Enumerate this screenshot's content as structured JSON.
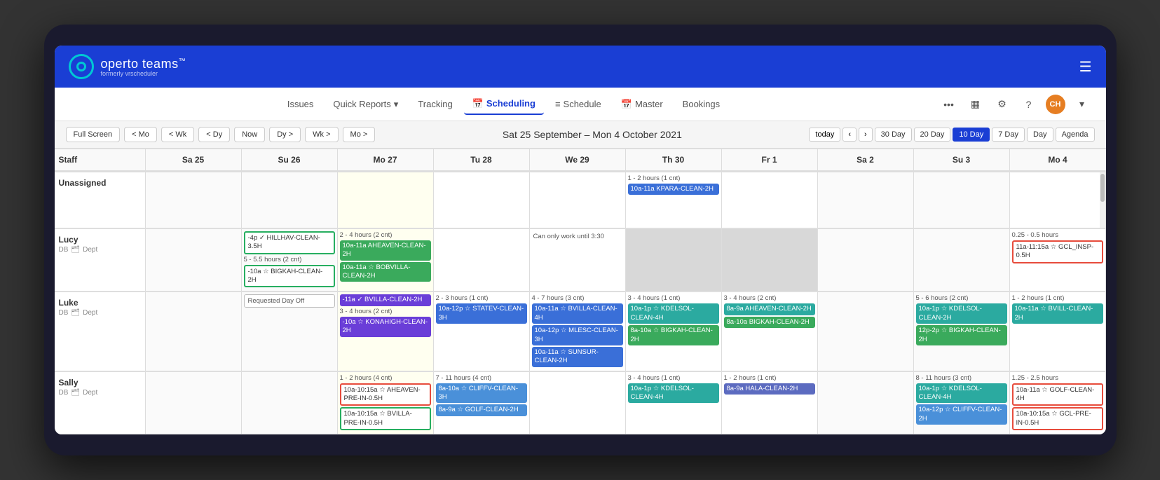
{
  "app": {
    "name": "operto",
    "name2": "teams",
    "trademark": "™",
    "subtitle": "formerly vrscheduler"
  },
  "nav": {
    "links": [
      {
        "id": "issues",
        "label": "Issues",
        "active": false
      },
      {
        "id": "quick-reports",
        "label": "Quick Reports",
        "active": false,
        "hasDropdown": true
      },
      {
        "id": "tracking",
        "label": "Tracking",
        "active": false
      },
      {
        "id": "scheduling",
        "label": "Scheduling",
        "active": true,
        "hasIcon": true
      },
      {
        "id": "schedule",
        "label": "Schedule",
        "active": false,
        "hasIcon": true
      },
      {
        "id": "master",
        "label": "Master",
        "active": false,
        "hasIcon": true
      },
      {
        "id": "bookings",
        "label": "Bookings",
        "active": false
      }
    ]
  },
  "toolbar": {
    "full_screen": "Full Screen",
    "prev_mo": "< Mo",
    "prev_wk": "< Wk",
    "prev_dy": "< Dy",
    "now": "Now",
    "next_dy": "Dy >",
    "next_wk": "Wk >",
    "next_mo": "Mo >",
    "date_range": "Sat 25 September – Mon 4 October 2021",
    "today": "today",
    "views": [
      "30 Day",
      "20 Day",
      "10 Day",
      "7 Day",
      "Day",
      "Agenda"
    ],
    "active_view": "10 Day"
  },
  "calendar": {
    "columns": [
      {
        "id": "staff",
        "label": "Staff"
      },
      {
        "id": "sa25",
        "label": "Sa 25"
      },
      {
        "id": "su26",
        "label": "Su 26"
      },
      {
        "id": "mo27",
        "label": "Mo 27"
      },
      {
        "id": "tu28",
        "label": "Tu 28"
      },
      {
        "id": "we29",
        "label": "We 29"
      },
      {
        "id": "th30",
        "label": "Th 30"
      },
      {
        "id": "fr1",
        "label": "Fr 1"
      },
      {
        "id": "sa2",
        "label": "Sa 2"
      },
      {
        "id": "su3",
        "label": "Su 3"
      },
      {
        "id": "mo4",
        "label": "Mo 4"
      }
    ],
    "rows": [
      {
        "id": "unassigned",
        "name": "Unassigned",
        "sub": "",
        "cells": {
          "sa25": {
            "events": []
          },
          "su26": {
            "events": []
          },
          "mo27": {
            "bg": "yellow",
            "events": []
          },
          "tu28": {
            "events": []
          },
          "we29": {
            "events": []
          },
          "th30": {
            "events": [
              {
                "type": "summary",
                "text": "1 - 2 hours (1 cnt)"
              },
              {
                "color": "blue",
                "text": "10a-11a KPARA-CLEAN-2H"
              }
            ]
          },
          "fr1": {
            "events": []
          },
          "sa2": {
            "events": []
          },
          "su3": {
            "events": []
          },
          "mo4": {
            "events": []
          }
        }
      },
      {
        "id": "lucy",
        "name": "Lucy",
        "sub": "DB Dept",
        "cells": {
          "sa25": {
            "events": []
          },
          "su26": {
            "events": [
              {
                "color": "outline-green",
                "text": "-4p ✓ HILLHAV-CLEAN-3.5H"
              },
              {
                "type": "summary",
                "text": "5 - 5.5 hours (2 cnt)"
              },
              {
                "color": "outline-green",
                "text": "-10a ☆ BIGKAH-CLEAN-2H"
              }
            ]
          },
          "mo27": {
            "events": [
              {
                "type": "summary",
                "text": "2 - 4 hours (2 cnt)"
              },
              {
                "color": "green",
                "text": "10a-11a AHEAVEN-CLEAN-2H"
              },
              {
                "color": "green",
                "text": "10a-11a ☆ BOBVILLA-CLEAN-2H"
              }
            ]
          },
          "tu28": {
            "events": []
          },
          "we29": {
            "text_note": "Can only work until 3:30",
            "events": []
          },
          "th30": {
            "bg": "gray",
            "events": []
          },
          "fr1": {
            "bg": "gray",
            "events": []
          },
          "sa2": {
            "events": []
          },
          "su3": {
            "events": []
          },
          "mo4": {
            "events": [
              {
                "type": "summary",
                "text": "0.25 - 0.5 hours"
              },
              {
                "color": "outline-red",
                "text": "11a-11:15a ☆ GCL_INSP-0.5H"
              }
            ]
          }
        }
      },
      {
        "id": "luke",
        "name": "Luke",
        "sub": "DB Dept",
        "cells": {
          "sa25": {
            "events": []
          },
          "su26": {
            "day_off": "Requested Day Off",
            "events": []
          },
          "mo27": {
            "events": [
              {
                "color": "purple",
                "text": "-11a ✓ BVILLA-CLEAN-2H"
              },
              {
                "type": "summary",
                "text": "3 - 4 hours (2 cnt)"
              },
              {
                "color": "purple",
                "text": "-10a ☆ KONAHIGH-CLEAN-2H"
              }
            ]
          },
          "tu28": {
            "events": [
              {
                "type": "summary",
                "text": "2 - 3 hours (1 cnt)"
              },
              {
                "color": "blue",
                "text": "10a-12p ☆ STATEV-CLEAN-3H"
              }
            ]
          },
          "we29": {
            "events": [
              {
                "type": "summary",
                "text": "4 - 7 hours (3 cnt)"
              },
              {
                "color": "blue",
                "text": "10a-11a ☆ BVILLA-CLEAN-4H"
              },
              {
                "color": "blue",
                "text": "10a-12p ☆ MLESC-CLEAN-3H"
              },
              {
                "color": "blue",
                "text": "10a-11a ☆ SUNSUR-CLEAN-2H"
              }
            ]
          },
          "th30": {
            "events": [
              {
                "type": "summary",
                "text": "3 - 4 hours (1 cnt)"
              },
              {
                "color": "teal",
                "text": "10a-1p ☆ KDELSOL-CLEAN-4H"
              },
              {
                "color": "green",
                "text": "8a-10a ☆ BIGKAH-CLEAN-2H"
              }
            ]
          },
          "fr1": {
            "events": [
              {
                "type": "summary",
                "text": "3 - 4 hours (2 cnt)"
              },
              {
                "color": "teal",
                "text": "8a-9a AHEAVEN-CLEAN-2H"
              },
              {
                "color": "green",
                "text": "8a-10a BIGKAH-CLEAN-2H"
              }
            ]
          },
          "sa2": {
            "events": []
          },
          "su3": {
            "events": [
              {
                "type": "summary",
                "text": "5 - 6 hours (2 cnt)"
              },
              {
                "color": "teal",
                "text": "10a-1p ☆ KDELSOL-CLEAN-2H"
              },
              {
                "color": "green",
                "text": "12p-2p ☆ BIGKAH-CLEAN-2H"
              }
            ]
          },
          "mo4": {
            "events": [
              {
                "type": "summary",
                "text": "1 - 2 hours (1 cnt)"
              },
              {
                "color": "teal",
                "text": "10a-11a ☆ BVILL-CLEAN-2H"
              }
            ]
          }
        }
      },
      {
        "id": "sally",
        "name": "Sally",
        "sub": "DB Dept",
        "cells": {
          "sa25": {
            "events": []
          },
          "su26": {
            "events": []
          },
          "mo27": {
            "events": [
              {
                "type": "summary",
                "text": "1 - 2 hours (4 cnt)"
              },
              {
                "color": "outline-red",
                "text": "10a-10:15a ☆ AHEAVEN-PRE-IN-0.5H"
              },
              {
                "color": "outline-green",
                "text": "10a-10:15a ☆ BVILLA-PRE-IN-0.5H"
              }
            ]
          },
          "tu28": {
            "events": [
              {
                "type": "summary",
                "text": "7 - 11 hours (4 cnt)"
              },
              {
                "color": "blue-light",
                "text": "8a-10a ☆ CLIFFV-CLEAN-3H"
              },
              {
                "color": "blue-light",
                "text": "8a-9a ☆ GOLF-CLEAN-2H"
              }
            ]
          },
          "we29": {
            "events": []
          },
          "th30": {
            "events": [
              {
                "type": "summary",
                "text": "3 - 4 hours (1 cnt)"
              },
              {
                "color": "teal",
                "text": "10a-1p ☆ KDELSOL-CLEAN-4H"
              }
            ]
          },
          "fr1": {
            "events": [
              {
                "type": "summary",
                "text": "1 - 2 hours (1 cnt)"
              },
              {
                "color": "indigo",
                "text": "8a-9a HALA-CLEAN-2H"
              }
            ]
          },
          "sa2": {
            "events": []
          },
          "su3": {
            "events": [
              {
                "type": "summary",
                "text": "8 - 11 hours (3 cnt)"
              },
              {
                "color": "teal",
                "text": "10a-1p ☆ KDELSOL-CLEAN-4H"
              },
              {
                "color": "blue-light",
                "text": "10a-12p ☆ CLIFFV-CLEAN-2H"
              }
            ]
          },
          "mo4": {
            "events": [
              {
                "type": "summary",
                "text": "1.25 - 2.5 hours"
              },
              {
                "color": "outline-red",
                "text": "10a-11a ☆ GOLF-CLEAN-4H"
              },
              {
                "color": "outline-red",
                "text": "10a-10:15a ☆ GCL-PRE-IN-0.5H"
              }
            ]
          }
        }
      }
    ]
  }
}
